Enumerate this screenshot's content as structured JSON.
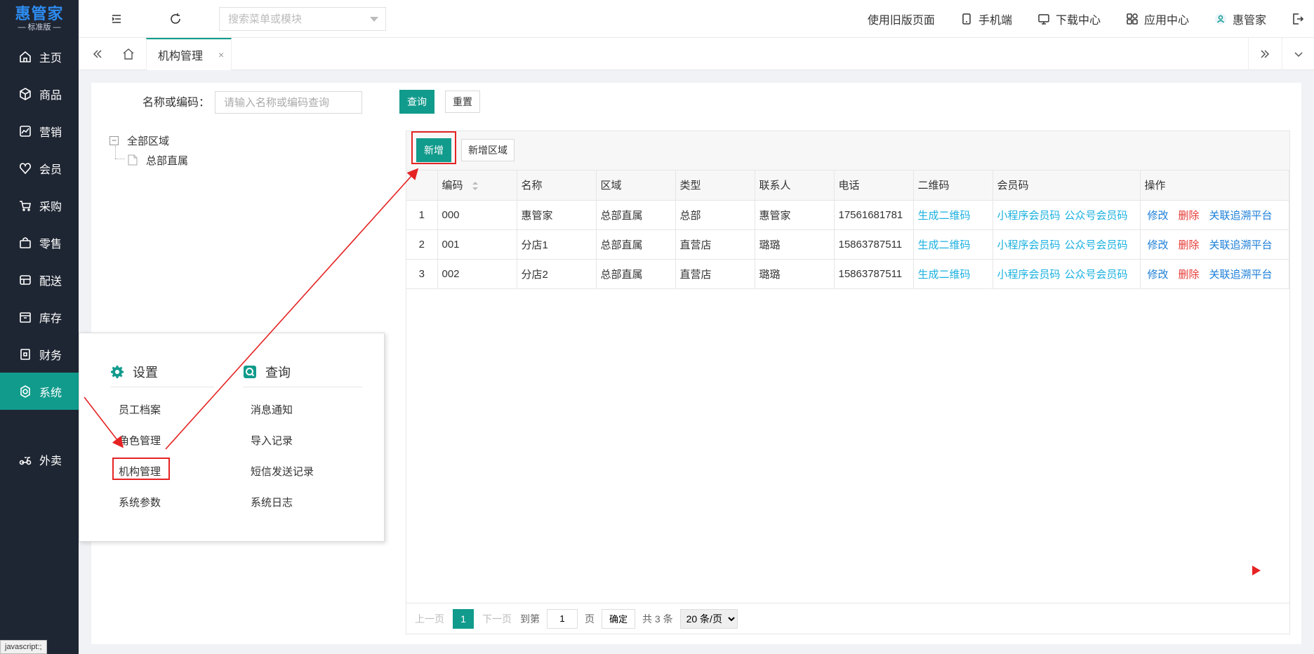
{
  "app": {
    "brand": "惠管家",
    "edition": "— 标准版 —"
  },
  "sidebar": {
    "items": [
      {
        "label": "主页",
        "icon": "home-icon"
      },
      {
        "label": "商品",
        "icon": "box-icon"
      },
      {
        "label": "营销",
        "icon": "chart-icon"
      },
      {
        "label": "会员",
        "icon": "heart-icon"
      },
      {
        "label": "采购",
        "icon": "cart-icon"
      },
      {
        "label": "零售",
        "icon": "bag-icon"
      },
      {
        "label": "配送",
        "icon": "truck-icon"
      },
      {
        "label": "库存",
        "icon": "warehouse-icon"
      },
      {
        "label": "财务",
        "icon": "wallet-icon"
      },
      {
        "label": "系统",
        "icon": "settings-icon",
        "active": true
      },
      {
        "label": "外卖",
        "icon": "scooter-icon"
      }
    ]
  },
  "header": {
    "search_placeholder": "搜索菜单或模块",
    "links": {
      "old_version": "使用旧版页面",
      "mobile": "手机端",
      "download": "下载中心",
      "apps": "应用中心",
      "user": "惠管家"
    }
  },
  "tabs": {
    "active": "机构管理",
    "close": "×"
  },
  "filter": {
    "label": "名称或编码：",
    "placeholder": "请输入名称或编码查询",
    "query": "查询",
    "reset": "重置"
  },
  "tree": {
    "root": "全部区域",
    "children": [
      "总部直属"
    ],
    "toggle": "−"
  },
  "toolbar": {
    "add": "新增",
    "add_region": "新增区域"
  },
  "table": {
    "columns": [
      "编码",
      "名称",
      "区域",
      "类型",
      "联系人",
      "电话",
      "二维码",
      "会员码",
      "操作"
    ],
    "rows": [
      {
        "idx": "1",
        "code": "000",
        "name": "惠管家",
        "region": "总部直属",
        "type": "总部",
        "contact": "惠管家",
        "phone": "17561681781"
      },
      {
        "idx": "2",
        "code": "001",
        "name": "分店1",
        "region": "总部直属",
        "type": "直营店",
        "contact": "璐璐",
        "phone": "15863787511"
      },
      {
        "idx": "3",
        "code": "002",
        "name": "分店2",
        "region": "总部直属",
        "type": "直营店",
        "contact": "璐璐",
        "phone": "15863787511"
      }
    ],
    "qr_link": "生成二维码",
    "mini_code": "小程序会员码",
    "gzh_code": "公众号会员码",
    "edit": "修改",
    "delete": "删除",
    "trace": "关联追溯平台"
  },
  "pager": {
    "prev": "上一页",
    "current": "1",
    "next": "下一页",
    "goto": "到第",
    "goto_value": "1",
    "page_unit": "页",
    "confirm": "确定",
    "total": "共 3 条",
    "page_size": "20 条/页"
  },
  "popup": {
    "settings_title": "设置",
    "query_title": "查询",
    "settings_items": [
      "员工档案",
      "角色管理",
      "机构管理",
      "系统参数"
    ],
    "query_items": [
      "消息通知",
      "导入记录",
      "短信发送记录",
      "系统日志"
    ]
  },
  "status_bar": "javascript:;",
  "colors": {
    "accent": "#119b8c",
    "sidebar": "#1f2633",
    "annotation": "#e52323"
  }
}
